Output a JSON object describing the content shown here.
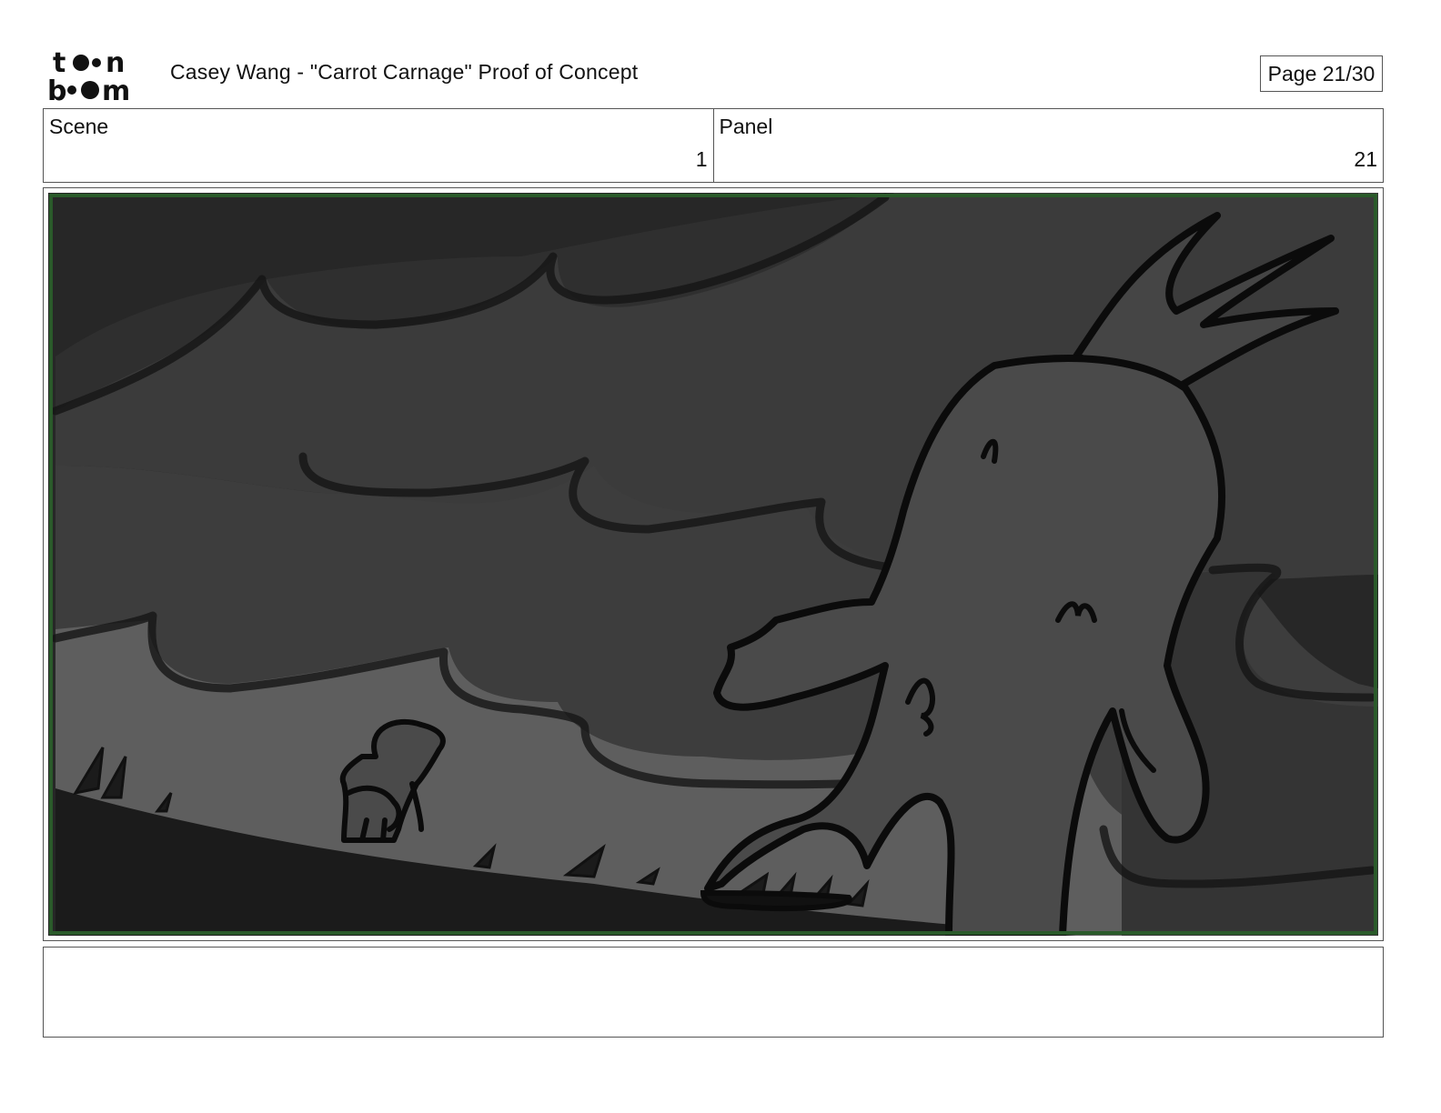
{
  "header": {
    "logo_text": "toonboom",
    "document_title": "Casey Wang - \"Carrot Carnage\" Proof of Concept",
    "page_indicator": "Page 21/30"
  },
  "info": {
    "scene_label": "Scene",
    "scene_value": "1",
    "panel_label": "Panel",
    "panel_value": "21"
  },
  "panel": {
    "icon": "storyboard-sketch-image",
    "colors": {
      "frame_border": "#2a5a2a",
      "sky_dark": "#272727",
      "cloud_mid": "#3d3d3d",
      "haze_light": "#5e5e5e",
      "ground": "#1b1b1b",
      "figure": "#4a4a4a"
    }
  },
  "notes": {
    "text": ""
  }
}
